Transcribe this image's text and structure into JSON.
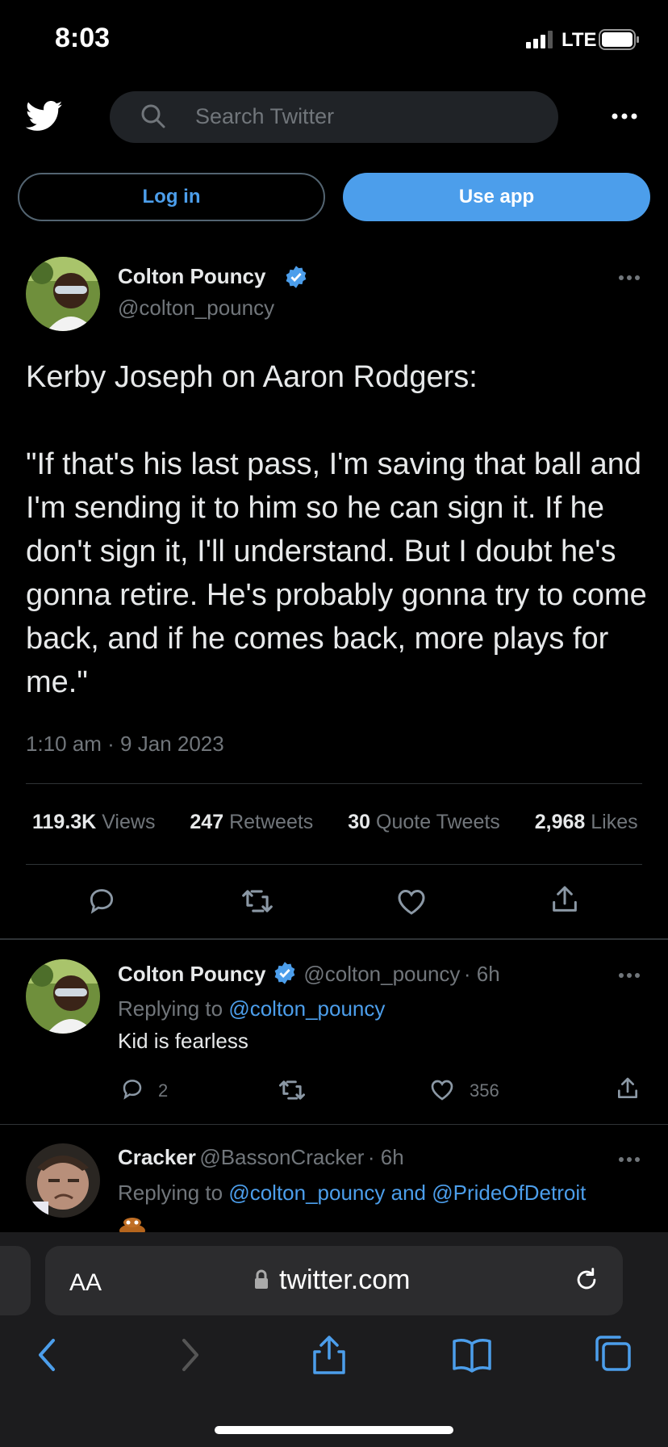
{
  "status_bar": {
    "time": "8:03",
    "network": "LTE"
  },
  "header": {
    "search_placeholder": "Search Twitter",
    "login_label": "Log in",
    "use_app_label": "Use app"
  },
  "tweet": {
    "author_name": "Colton Pouncy",
    "author_handle": "@colton_pouncy",
    "text": "Kerby Joseph on Aaron Rodgers:\n\n\"If that's his last pass, I'm saving that ball and I'm sending it to him so he can sign it. If he don't sign it, I'll understand. But I doubt he's gonna retire. He's probably gonna try to come back, and if he comes back, more plays for me.\"",
    "timestamp": "1:10 am · 9 Jan 2023",
    "stats": [
      {
        "value": "119.3K",
        "label": "Views"
      },
      {
        "value": "247",
        "label": "Retweets"
      },
      {
        "value": "30",
        "label": "Quote Tweets"
      },
      {
        "value": "2,968",
        "label": "Likes"
      }
    ]
  },
  "replies": [
    {
      "name": "Colton Pouncy",
      "handle": "@colton_pouncy",
      "age": "· 6h",
      "replying_prefix": "Replying to ",
      "replying_to": "@colton_pouncy",
      "text": "Kid is fearless",
      "reply_count": "2",
      "like_count": "356"
    },
    {
      "name": "Cracker",
      "handle": "@BassonCracker",
      "age": "· 6h",
      "replying_prefix": "Replying to ",
      "replying_to": "@colton_pouncy and @PrideOfDetroit"
    }
  ],
  "browser": {
    "aa_label": "AA",
    "url": "twitter.com"
  },
  "colors": {
    "accent": "#4c9eeb",
    "background": "#000000",
    "muted": "#71767b"
  },
  "icons": [
    "twitter-bird-icon",
    "search-icon",
    "more-icon",
    "verified-icon",
    "reply-icon",
    "retweet-icon",
    "like-icon",
    "share-icon",
    "lock-icon",
    "reload-icon",
    "back-icon",
    "forward-icon",
    "book-icon",
    "tabs-icon"
  ]
}
